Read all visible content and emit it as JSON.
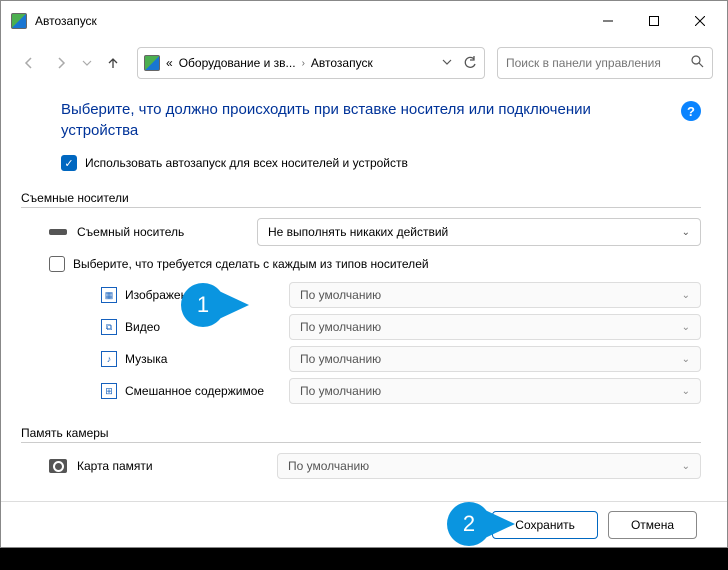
{
  "window": {
    "title": "Автозапуск"
  },
  "breadcrumb": {
    "prefix": "«",
    "items": [
      "Оборудование и зв...",
      "Автозапуск"
    ]
  },
  "search": {
    "placeholder": "Поиск в панели управления"
  },
  "heading": "Выберите, что должно происходить при вставке носителя или подключении устройства",
  "use_autoplay": {
    "label": "Использовать автозапуск для всех носителей и устройств",
    "checked": true
  },
  "sections": {
    "removable": {
      "title": "Съемные носители",
      "drive_label": "Съемный носитель",
      "drive_action": "Не выполнять никаких действий",
      "choose_per_type": {
        "label": "Выберите, что требуется сделать с каждым из типов носителей",
        "checked": false
      },
      "types": [
        {
          "icon": "▦",
          "label": "Изображения",
          "value": "По умолчанию"
        },
        {
          "icon": "⧉",
          "label": "Видео",
          "value": "По умолчанию"
        },
        {
          "icon": "♪",
          "label": "Музыка",
          "value": "По умолчанию"
        },
        {
          "icon": "⊞",
          "label": "Смешанное содержимое",
          "value": "По умолчанию"
        }
      ]
    },
    "camera": {
      "title": "Память камеры",
      "label": "Карта памяти",
      "value": "По умолчанию"
    }
  },
  "buttons": {
    "save": "Сохранить",
    "cancel": "Отмена"
  },
  "help_badge": "?",
  "annotations": {
    "one": "1",
    "two": "2"
  }
}
